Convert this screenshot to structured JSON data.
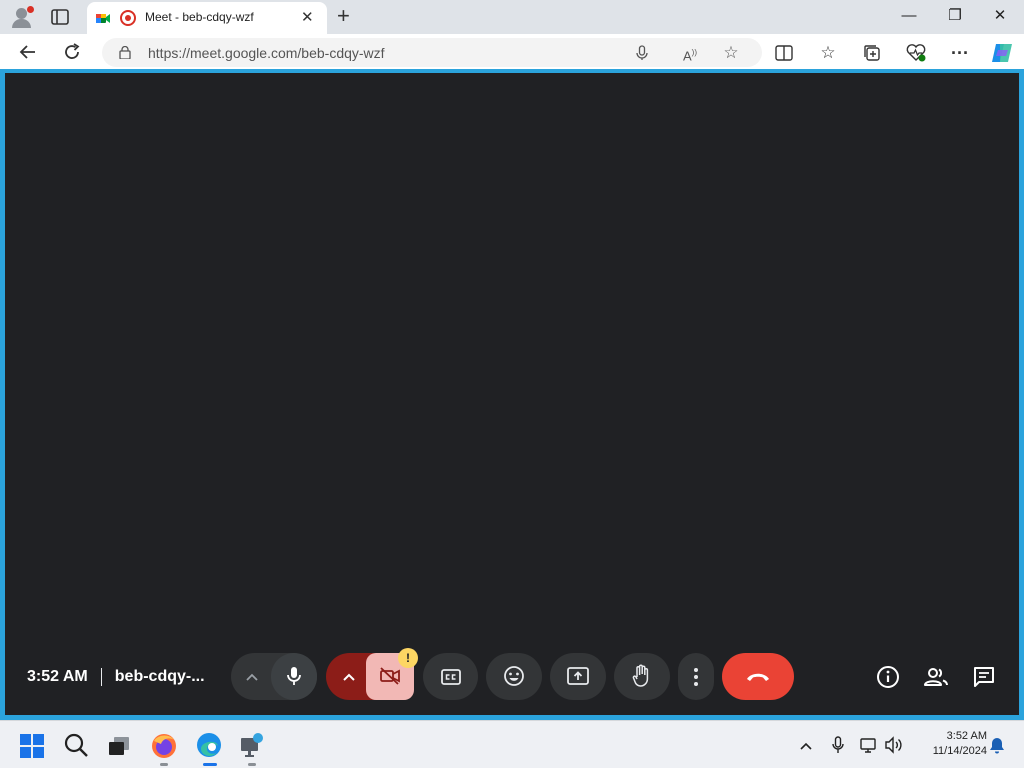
{
  "browser": {
    "tab_title": "Meet - beb-cdqy-wzf",
    "tab_close": "✕",
    "new_tab": "+",
    "url": "https://meet.google.com/beb-cdqy-wzf",
    "window_controls": {
      "minimize": "—",
      "restore": "❐",
      "close": "✕"
    },
    "icons": [
      "profile-icon",
      "tab-actions-icon",
      "google-meet-favicon",
      "recording-icon",
      "back-icon",
      "refresh-icon",
      "lock-icon",
      "microphone-icon",
      "read-aloud-icon",
      "favorite-star-icon",
      "split-screen-icon",
      "favorites-icon",
      "collections-icon",
      "browser-essentials-icon",
      "more-icon",
      "copilot-icon"
    ]
  },
  "meeting": {
    "time": "3:52 AM",
    "code": "beb-cdqy-...",
    "camera_warning_badge": "!",
    "controls": [
      "audio-options",
      "microphone",
      "video-options",
      "camera-off",
      "captions",
      "reactions",
      "present-screen",
      "raise-hand",
      "more-options",
      "leave-call"
    ],
    "side_controls": [
      "meeting-details",
      "people",
      "chat"
    ],
    "colors": {
      "background": "#202124",
      "control": "#333537",
      "end_call": "#ea4335",
      "camera_off": "#f2b8b5",
      "camera_menu": "#8c1d18",
      "warning": "#fdd663"
    }
  },
  "taskbar": {
    "time": "3:52 AM",
    "date": "11/14/2024",
    "apps": [
      "start",
      "search",
      "task-view",
      "firefox",
      "edge",
      "remote-desktop"
    ]
  }
}
